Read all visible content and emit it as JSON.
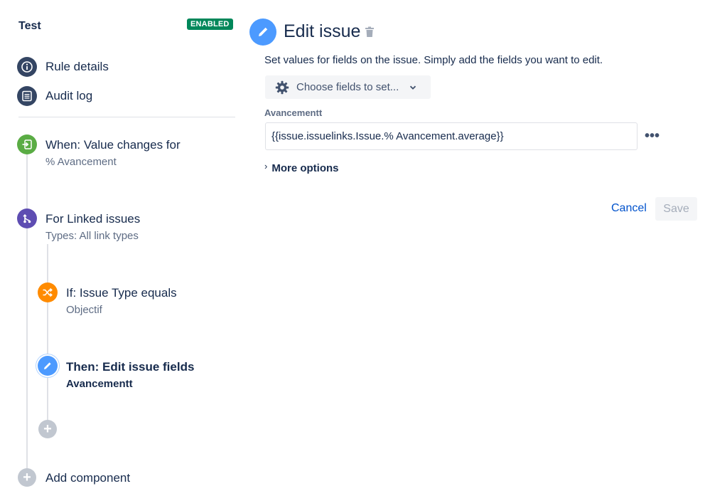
{
  "rule": {
    "name": "Test",
    "status_badge": "ENABLED"
  },
  "nav": [
    {
      "label": "Rule details",
      "icon": "info-icon"
    },
    {
      "label": "Audit log",
      "icon": "list-icon"
    }
  ],
  "components": [
    {
      "title": "When: Value changes for",
      "subtitle": "% Avancement",
      "icon": "trigger-icon",
      "color": "#5aac44"
    },
    {
      "title": "For Linked issues",
      "subtitle": "Types: All link types",
      "icon": "branch-icon",
      "color": "#5e4db2"
    },
    {
      "title": "If: Issue Type equals",
      "subtitle": "Objectif",
      "icon": "shuffle-icon",
      "color": "#ff8b00"
    },
    {
      "title": "Then: Edit issue fields",
      "subtitle": "Avancementt",
      "icon": "pencil-icon",
      "color": "#4c9aff"
    }
  ],
  "add_component_label": "Add component",
  "editor": {
    "title": "Edit issue",
    "description": "Set values for fields on the issue. Simply add the fields you want to edit.",
    "choose_fields_label": "Choose fields to set...",
    "field_label": "Avancementt",
    "field_value": "{{issue.issuelinks.Issue.% Avancement.average}}",
    "more_options_label": "More options",
    "cancel_label": "Cancel",
    "save_label": "Save"
  }
}
